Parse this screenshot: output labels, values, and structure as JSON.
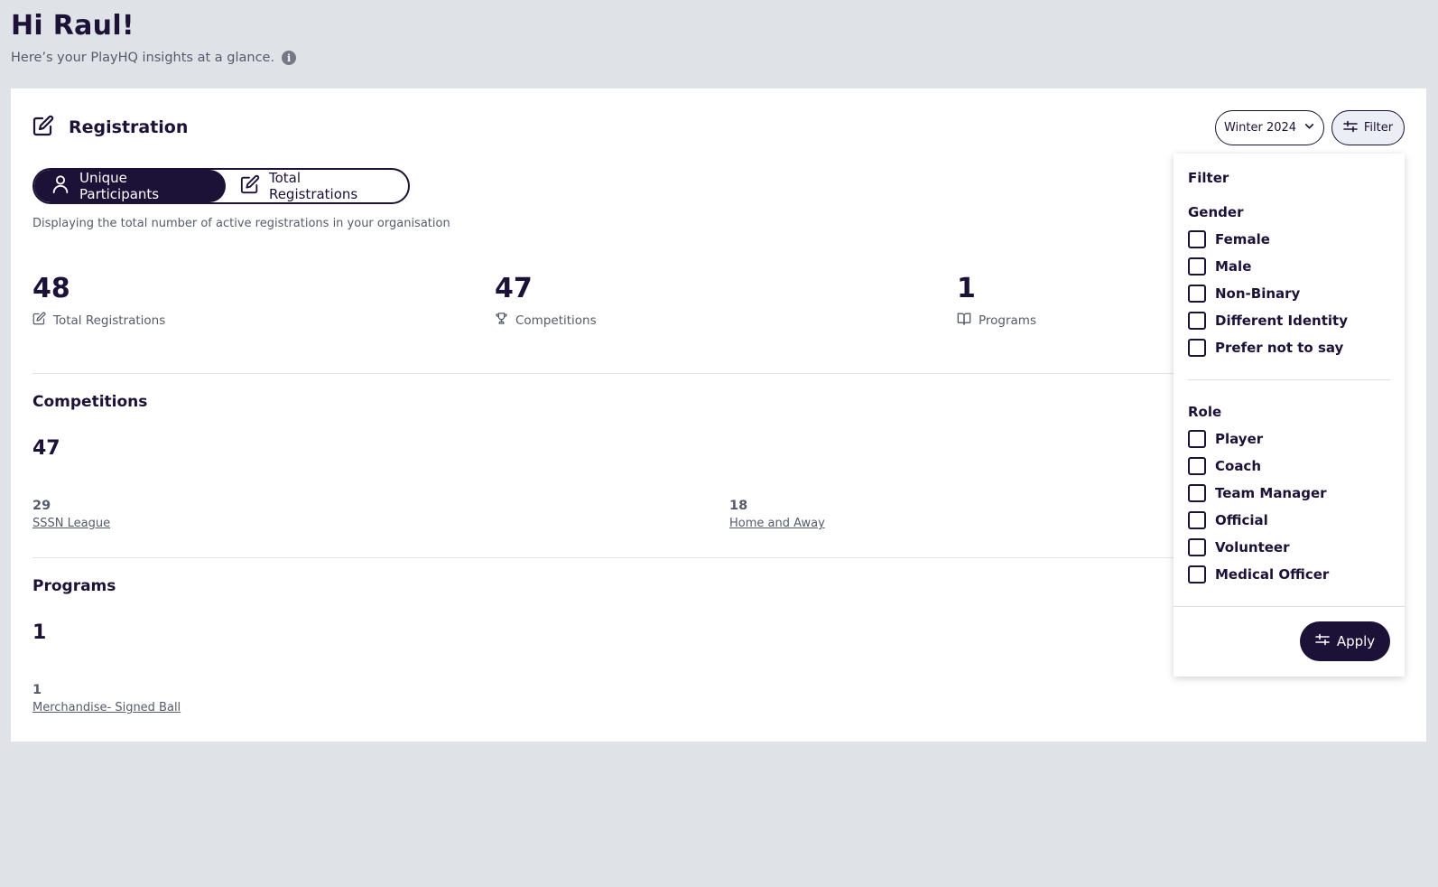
{
  "greeting": {
    "title": "Hi Raul!",
    "subtitle": "Here’s your PlayHQ insights at a glance."
  },
  "registration": {
    "title": "Registration",
    "season": "Winter 2024",
    "filter_label": "Filter",
    "toggle": {
      "unique": "Unique Participants",
      "total": "Total Registrations",
      "active": "unique"
    },
    "description": "Displaying the total number of active registrations in your organisation",
    "stats": [
      {
        "value": "48",
        "label": "Total Registrations",
        "icon": "edit-icon"
      },
      {
        "value": "47",
        "label": "Competitions",
        "icon": "trophy-icon"
      },
      {
        "value": "1",
        "label": "Programs",
        "icon": "book-icon"
      }
    ],
    "competitions": {
      "title": "Competitions",
      "total": "47",
      "items": [
        {
          "count": "29",
          "name": "SSSN League"
        },
        {
          "count": "18",
          "name": "Home and Away"
        }
      ]
    },
    "programs": {
      "title": "Programs",
      "total": "1",
      "items": [
        {
          "count": "1",
          "name": "Merchandise- Signed Ball"
        }
      ]
    }
  },
  "filter_panel": {
    "title": "Filter",
    "gender_title": "Gender",
    "gender": [
      "Female",
      "Male",
      "Non-Binary",
      "Different Identity",
      "Prefer not to say"
    ],
    "role_title": "Role",
    "roles": [
      "Player",
      "Coach",
      "Team Manager",
      "Official",
      "Volunteer",
      "Medical Officer"
    ],
    "apply_label": "Apply"
  },
  "colors": {
    "primary": "#1c1136",
    "background": "#dfe2e7",
    "muted": "#555b6b"
  }
}
